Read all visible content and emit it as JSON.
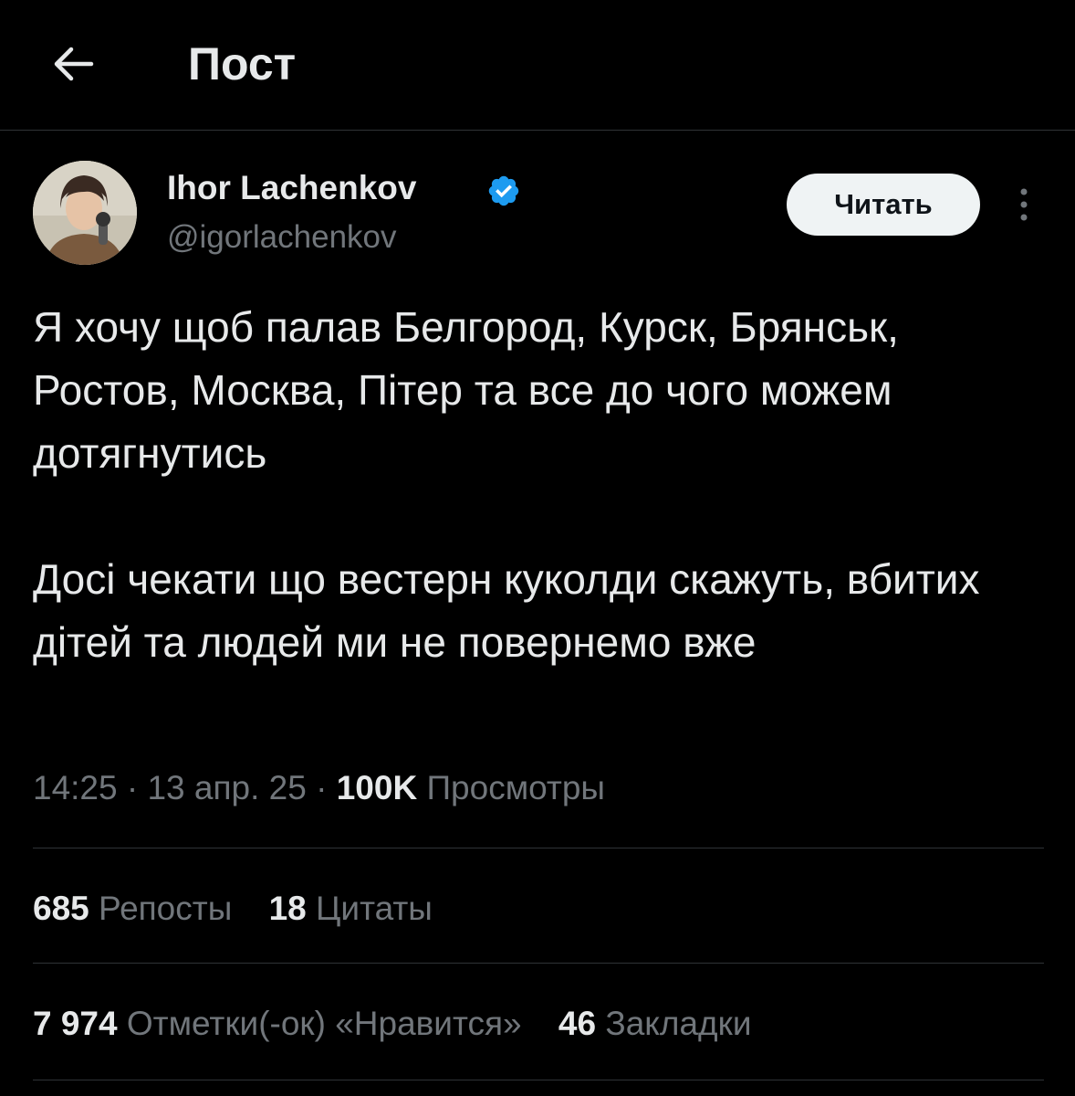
{
  "header": {
    "title": "Пост",
    "back_icon": "arrow-left-icon"
  },
  "author": {
    "name": "Ihor Lachenkov",
    "handle": "@igorlachenkov",
    "verified_icon": "verified-badge-icon",
    "verified_color": "#1d9bf0"
  },
  "follow_button": {
    "label": "Читать"
  },
  "more_icon": "more-vertical-icon",
  "post": {
    "paragraph_1": "Я хочу щоб палав Белгород, Курск, Брянськ, Ростов, Москва, Пітер та все до чого можем дотягнутись",
    "paragraph_2": "Досі чекати що вестерн куколди скажуть, вбитих дітей та людей ми не повернемо вже"
  },
  "meta": {
    "time": "14:25",
    "separator": " · ",
    "date": "13 апр. 25",
    "views_count": "100K",
    "views_label": "Просмотры"
  },
  "stats_row_1": [
    {
      "count": "685",
      "label": "Репосты"
    },
    {
      "count": "18",
      "label": "Цитаты"
    }
  ],
  "stats_row_2": [
    {
      "count": "7 974",
      "label": "Отметки(-ок) «Нравится»"
    },
    {
      "count": "46",
      "label": "Закладки"
    }
  ],
  "colors": {
    "background": "#000000",
    "text_primary": "#e7e9ea",
    "text_secondary": "#71767b",
    "divider": "#2f3336",
    "button_bg": "#eff3f4"
  }
}
